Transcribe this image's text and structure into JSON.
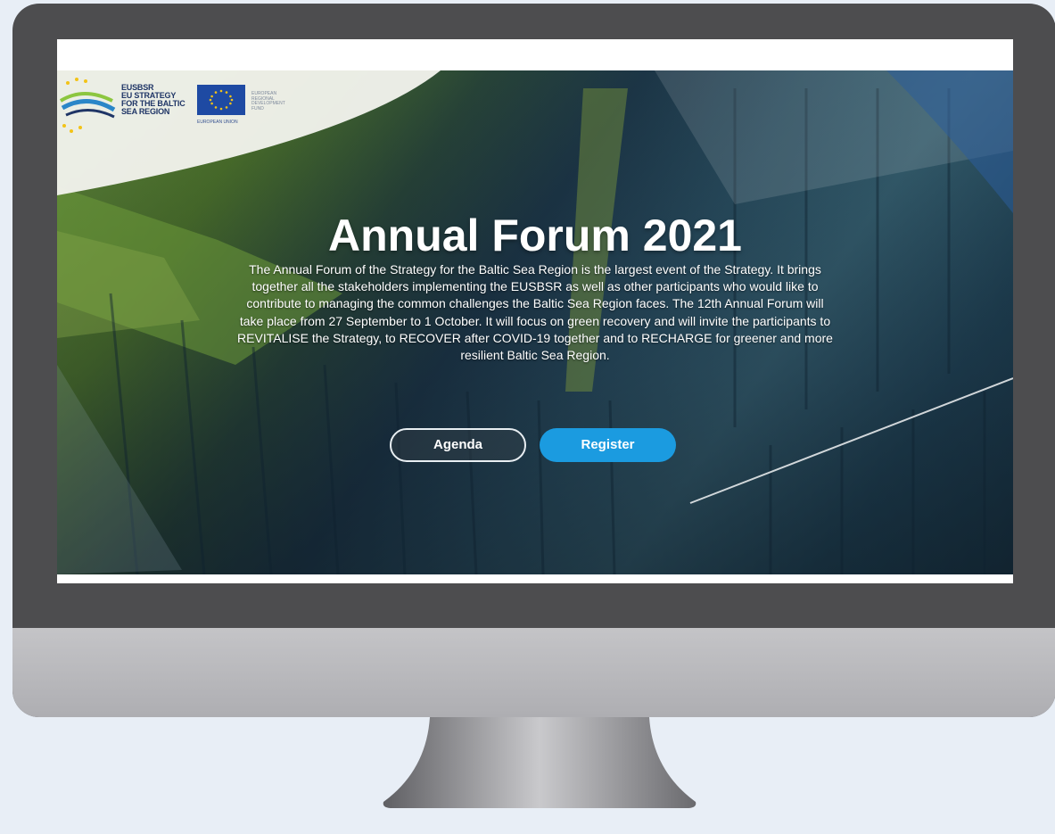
{
  "logos": {
    "eusbsr_lines": [
      "EUSBSR",
      "EU STRATEGY",
      "FOR THE BALTIC",
      "SEA REGION"
    ],
    "eu_caption": "EUROPEAN UNION",
    "erdf_lines": [
      "EUROPEAN",
      "REGIONAL",
      "DEVELOPMENT",
      "FUND"
    ]
  },
  "hero": {
    "title": "Annual Forum 2021",
    "description": "The Annual Forum of the Strategy for the Baltic Sea Region is the largest event of the Strategy. It brings together all the stakeholders implementing the EUSBSR as well as other participants who would like to contribute to managing the common challenges the Baltic Sea Region faces. The 12th Annual Forum will take place from 27 September to 1 October. It will focus on green recovery and will invite the participants to REVITALISE the Strategy, to RECOVER after COVID-19 together and to RECHARGE for greener and more resilient Baltic Sea Region."
  },
  "buttons": {
    "agenda": "Agenda",
    "register": "Register"
  },
  "colors": {
    "accent_blue": "#1b9be0",
    "eu_flag_blue": "#1e4aa3",
    "monitor_frame": "#4d4d4f",
    "background": "#e8eef6"
  },
  "icons": {
    "eu_flag": "eu-flag-icon",
    "eusbsr_logo": "eusbsr-logo-icon"
  }
}
